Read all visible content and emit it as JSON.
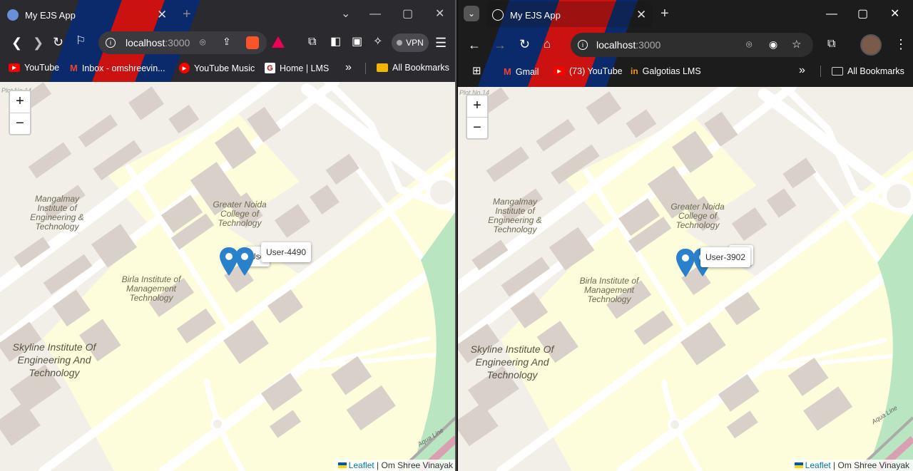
{
  "left": {
    "tab_title": "My EJS App",
    "new_tab": "+",
    "address": {
      "host": "localhost",
      "port": ":3000"
    },
    "vpn": "VPN",
    "bookmarks": [
      "YouTube",
      "Inbox - omshreevin...",
      "YouTube Music",
      "Home | LMS"
    ],
    "more": "»",
    "all_bookmarks": "All Bookmarks",
    "map": {
      "plot_label": "Plot No 14",
      "labels": {
        "mangalmay": "Mangalmay Institute of Engineering & Technology",
        "greater_noida": "Greater Noida College of Technology",
        "birla": "Birla Institute of Management Technology",
        "skyline": "Skyline Institute Of Engineering And Technology"
      },
      "popup_back": "Use",
      "popup_front": "User-4490",
      "zoom_in": "+",
      "zoom_out": "−",
      "attribution": {
        "leaflet": "Leaflet",
        "text": "| Om Shree Vinayak"
      }
    }
  },
  "right": {
    "tab_title": "My EJS App",
    "new_tab": "+",
    "address": {
      "host": "localhost",
      "port": ":3000"
    },
    "bookmarks": [
      "Gmail",
      "(73) YouTube",
      "Galgotias LMS"
    ],
    "more": "»",
    "all_bookmarks": "All Bookmarks",
    "map": {
      "plot_label": "Plot No 14",
      "labels": {
        "mangalmay": "Mangalmay Institute of Engineering & Technology",
        "greater_noida": "Greater Noida College of Technology",
        "birla": "Birla Institute of Management Technology",
        "skyline": "Skyline Institute Of Engineering And Technology",
        "aqua_line": "Aqua Line"
      },
      "popup_back": "490",
      "popup_front": "User-3902",
      "zoom_in": "+",
      "zoom_out": "−",
      "attribution": {
        "leaflet": "Leaflet",
        "text": "| Om Shree Vinayak"
      }
    }
  },
  "colors": {
    "theme_blue": "#0b2a6b",
    "theme_red": "#cc1111",
    "marker": "#2a81cb",
    "road": "#ffffff",
    "building": "#d9d0c9",
    "campus": "#fdfcdb"
  }
}
